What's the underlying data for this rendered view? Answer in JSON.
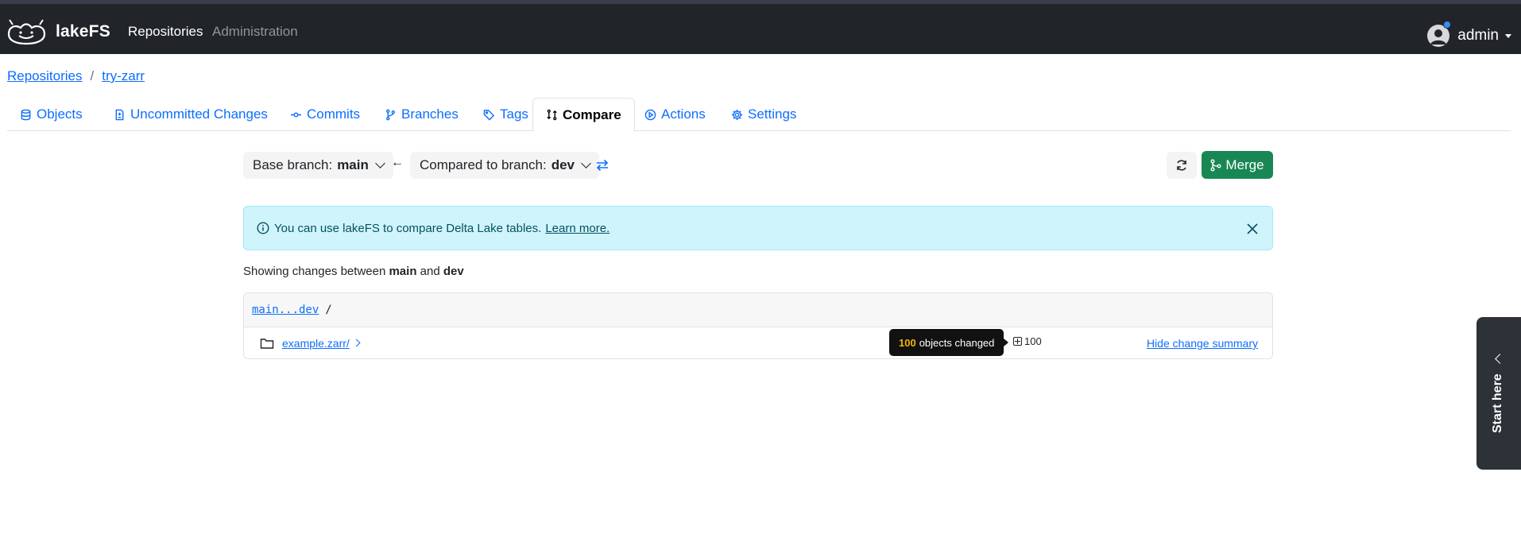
{
  "navbar": {
    "brand": "lakeFS",
    "links": {
      "repositories": "Repositories",
      "administration": "Administration"
    },
    "user": "admin"
  },
  "breadcrumb": {
    "root": "Repositories",
    "repo": "try-zarr",
    "separator": "/"
  },
  "tabs": [
    {
      "label": "Objects",
      "icon": "database-icon"
    },
    {
      "label": "Uncommitted Changes",
      "icon": "file-diff-icon"
    },
    {
      "label": "Commits",
      "icon": "git-commit-icon"
    },
    {
      "label": "Branches",
      "icon": "git-branch-icon"
    },
    {
      "label": "Tags",
      "icon": "tag-icon"
    },
    {
      "label": "Compare",
      "icon": "git-compare-icon",
      "active": true
    },
    {
      "label": "Actions",
      "icon": "play-icon"
    },
    {
      "label": "Settings",
      "icon": "gear-icon"
    }
  ],
  "compare": {
    "base_label": "Base branch:",
    "base_value": "main",
    "compared_label": "Compared to branch:",
    "compared_value": "dev",
    "arrow": "←",
    "merge_label": "Merge"
  },
  "alert": {
    "text": "You can use lakeFS to compare Delta Lake tables.",
    "link": "Learn more."
  },
  "showing": {
    "prefix": "Showing changes between",
    "base": "main",
    "and": "and",
    "compared": "dev"
  },
  "changes": {
    "ref": "main...dev",
    "slash": "/",
    "rows": [
      {
        "path": "example.zarr/",
        "tooltip_count": "100",
        "tooltip_text": "objects changed",
        "added_count": "100",
        "hide_label": "Hide change summary"
      }
    ]
  },
  "side_widget": {
    "label": "Start here"
  },
  "colors": {
    "navbar": "#212529",
    "link": "#0d6efd",
    "merge": "#198754",
    "alert_bg": "#cff4fc",
    "tooltip_accent": "#f5b300"
  }
}
